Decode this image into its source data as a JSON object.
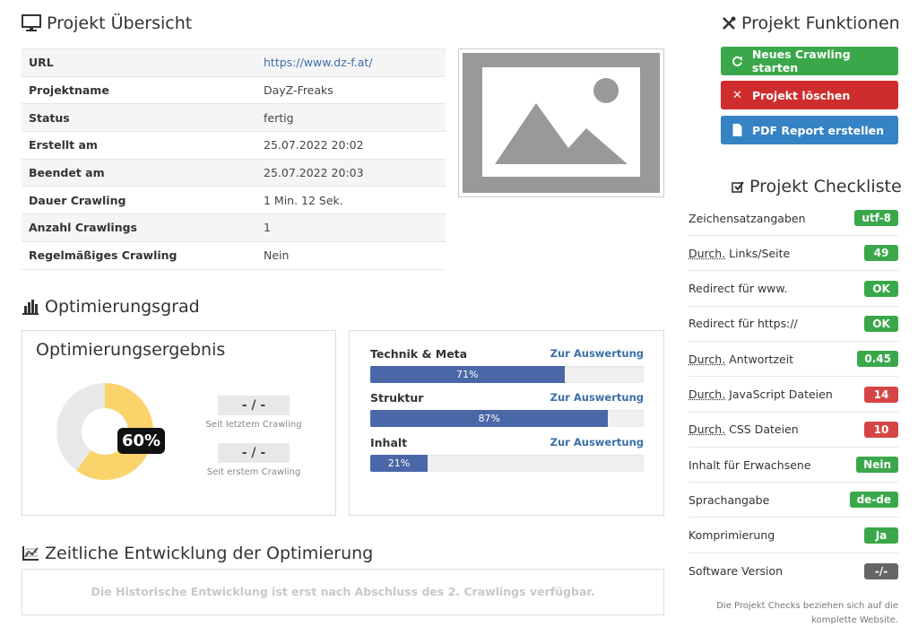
{
  "overview": {
    "title": "Projekt Übersicht",
    "rows": [
      {
        "key": "URL",
        "value": "https://www.dz-f.at/"
      },
      {
        "key": "Projektname",
        "value": "DayZ-Freaks"
      },
      {
        "key": "Status",
        "value": "fertig"
      },
      {
        "key": "Erstellt am",
        "value": "25.07.2022 20:02"
      },
      {
        "key": "Beendet am",
        "value": "25.07.2022 20:03"
      },
      {
        "key": "Dauer Crawling",
        "value": "1 Min. 12 Sek."
      },
      {
        "key": "Anzahl Crawlings",
        "value": "1"
      },
      {
        "key": "Regelmäßiges Crawling",
        "value": "Nein"
      }
    ]
  },
  "optimization": {
    "title": "Optimierungsgrad",
    "result_title": "Optimierungsergebnis",
    "percent_label": "60%",
    "percent_value": 0.6,
    "since_last_value": "- / -",
    "since_last_label": "Seit letztem Crawling",
    "since_first_value": "- / -",
    "since_first_label": "Seit erstem Crawling",
    "categories": [
      {
        "name": "Technik & Meta",
        "link": "Zur Auswertung",
        "label": "71%",
        "value": 0.71
      },
      {
        "name": "Struktur",
        "link": "Zur Auswertung",
        "label": "87%",
        "value": 0.87
      },
      {
        "name": "Inhalt",
        "link": "Zur Auswertung",
        "label": "21%",
        "value": 0.21
      }
    ]
  },
  "history": {
    "title": "Zeitliche Entwicklung der Optimierung",
    "message": "Die Historische Entwicklung ist erst nach Abschluss des 2. Crawlings verfügbar."
  },
  "functions": {
    "title": "Projekt Funktionen",
    "buttons": {
      "new_crawl": "Neues Crawling starten",
      "delete": "Projekt löschen",
      "pdf": "PDF Report erstellen"
    }
  },
  "checklist": {
    "title": "Projekt Checkliste",
    "items": [
      {
        "prefix": "",
        "label": "Zeichensatzangaben",
        "badge": "utf-8",
        "color": "#3aa84a"
      },
      {
        "prefix": "Durch.",
        "label": " Links/Seite",
        "badge": "49",
        "color": "#3aa84a"
      },
      {
        "prefix": "",
        "label": "Redirect für www.",
        "badge": "OK",
        "color": "#3aa84a"
      },
      {
        "prefix": "",
        "label": "Redirect für https://",
        "badge": "OK",
        "color": "#3aa84a"
      },
      {
        "prefix": "Durch.",
        "label": " Antwortzeit",
        "badge": "0.45",
        "color": "#3aa84a"
      },
      {
        "prefix": "Durch.",
        "label": " JavaScript Dateien",
        "badge": "14",
        "color": "#d64545"
      },
      {
        "prefix": "Durch.",
        "label": " CSS Dateien",
        "badge": "10",
        "color": "#d64545"
      },
      {
        "prefix": "",
        "label": "Inhalt für Erwachsene",
        "badge": "Nein",
        "color": "#3aa84a"
      },
      {
        "prefix": "",
        "label": "Sprachangabe",
        "badge": "de-de",
        "color": "#3aa84a"
      },
      {
        "prefix": "",
        "label": "Komprimierung",
        "badge": "Ja",
        "color": "#3aa84a"
      },
      {
        "prefix": "",
        "label": "Software Version",
        "badge": "-/-",
        "color": "#666666"
      }
    ],
    "note": "Die Projekt Checks beziehen sich auf die komplette Website."
  }
}
